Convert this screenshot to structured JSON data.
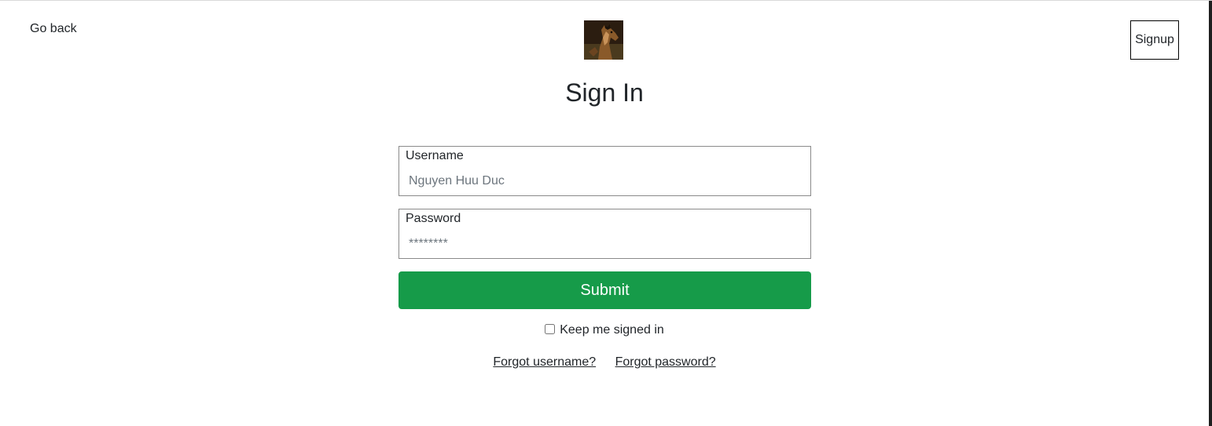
{
  "nav": {
    "go_back_label": "Go back",
    "signup_label": "Signup"
  },
  "logo": {
    "icon": "horse-avatar-icon"
  },
  "title": "Sign In",
  "form": {
    "username_label": "Username",
    "username_placeholder": "Nguyen Huu Duc",
    "password_label": "Password",
    "password_placeholder": "********",
    "submit_label": "Submit",
    "keep_signed_in_label": "Keep me signed in",
    "keep_signed_in_checked": false
  },
  "links": {
    "forgot_username": "Forgot username?",
    "forgot_password": "Forgot password?"
  },
  "colors": {
    "submit_bg": "#169b49",
    "text": "#212529"
  }
}
